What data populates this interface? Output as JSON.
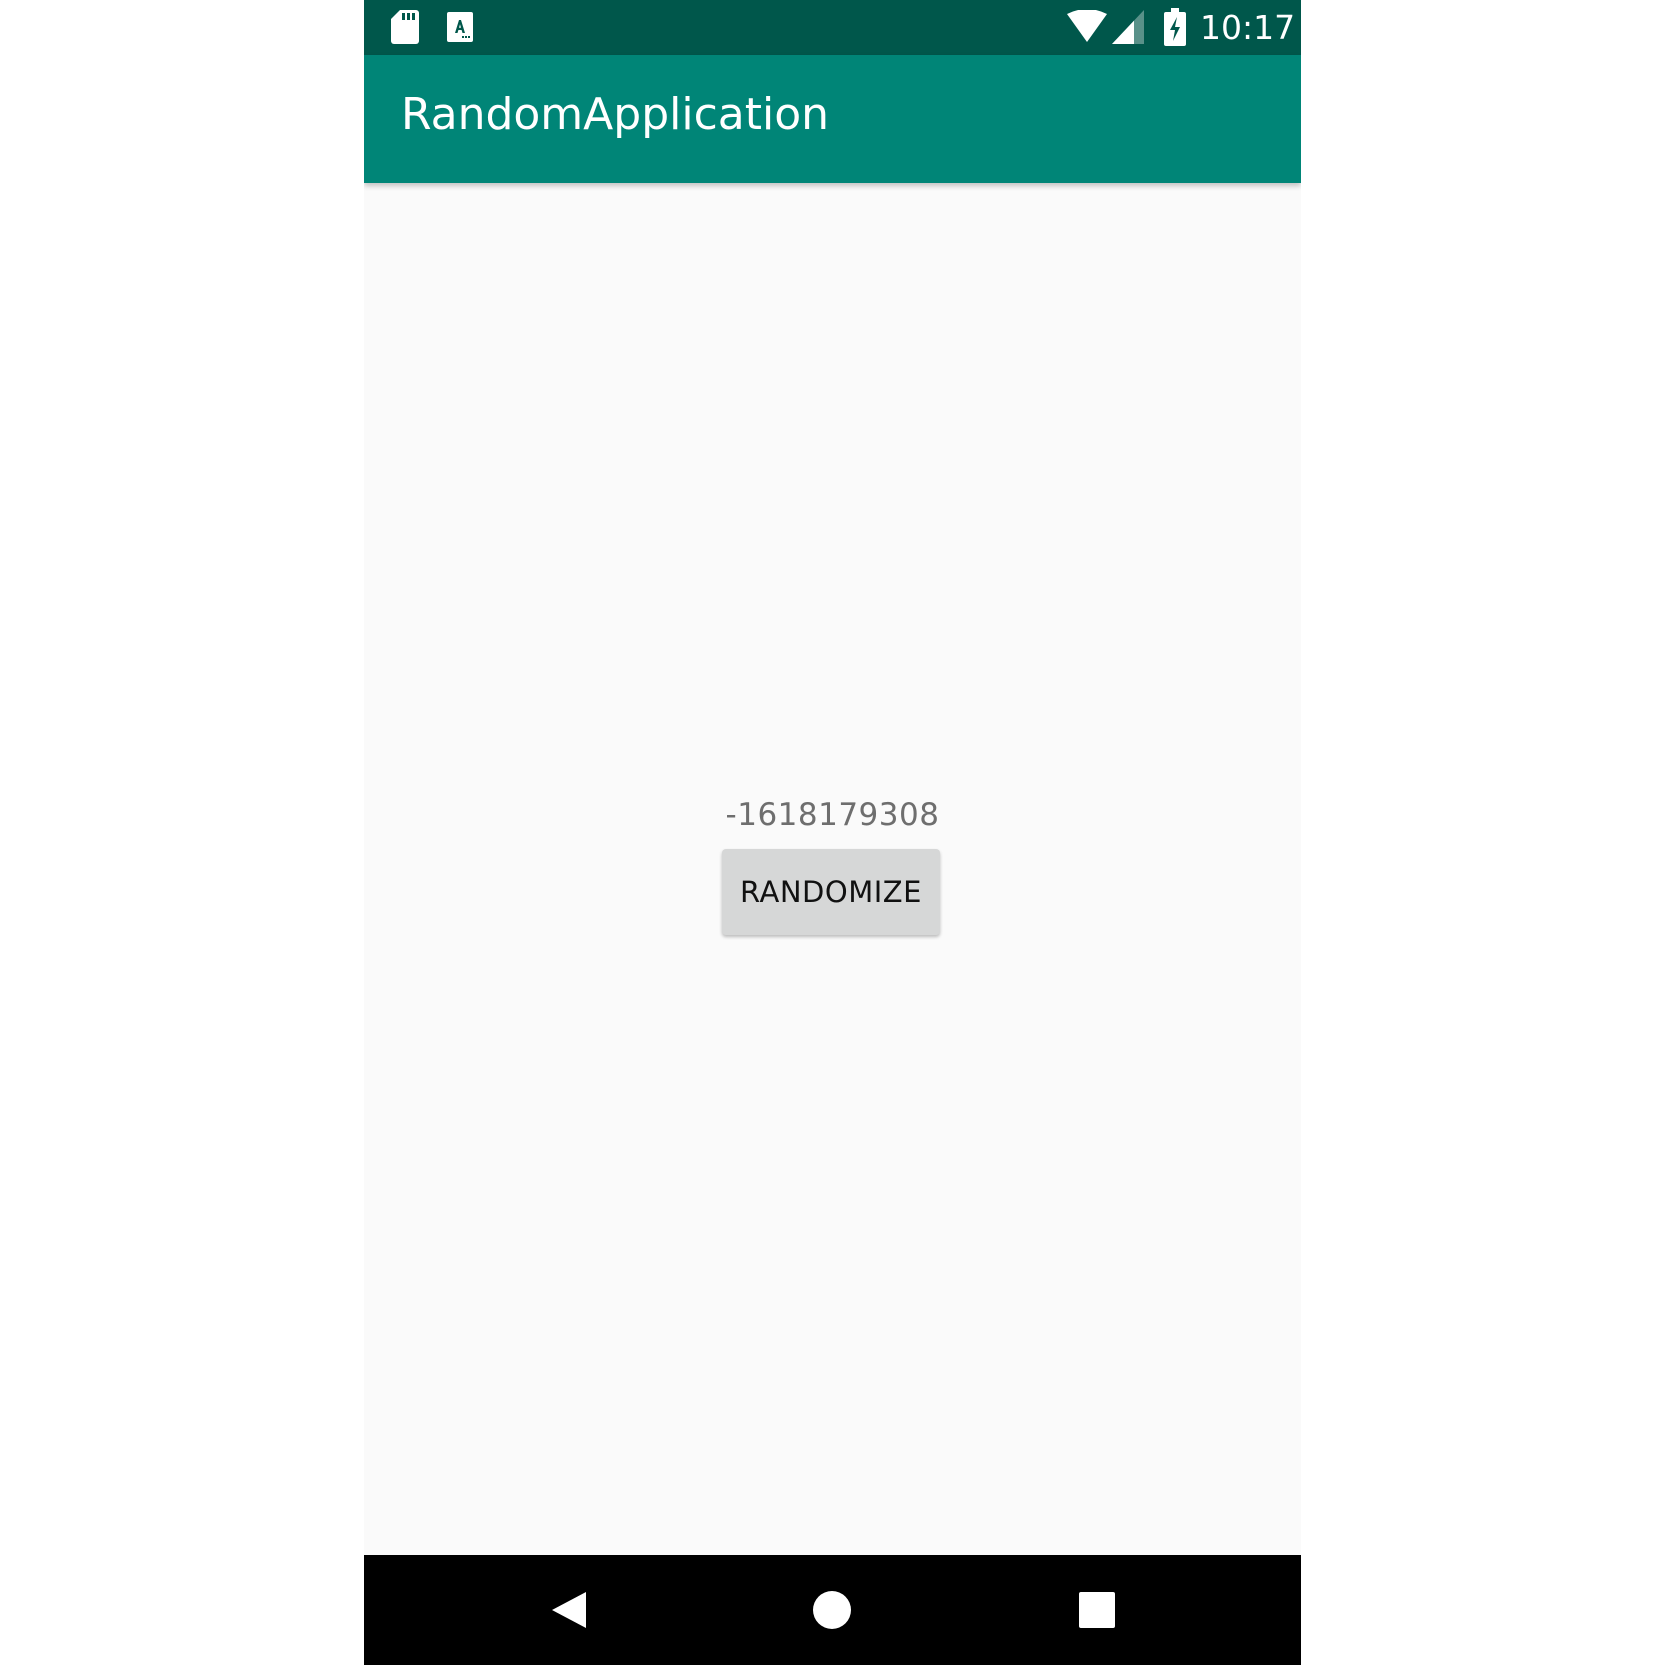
{
  "status_bar": {
    "time": "10:17",
    "icons": [
      "sd-card-icon",
      "keyboard-a-icon",
      "wifi-icon",
      "cell-signal-icon",
      "battery-charging-icon"
    ],
    "background_color": "#00574b"
  },
  "app_bar": {
    "title": "RandomApplication",
    "background_color": "#008577"
  },
  "main": {
    "random_value": "-1618179308",
    "randomize_button_label": "RANDOMIZE"
  },
  "nav_bar": {
    "icons": [
      "back-icon",
      "home-icon",
      "recents-icon"
    ]
  }
}
